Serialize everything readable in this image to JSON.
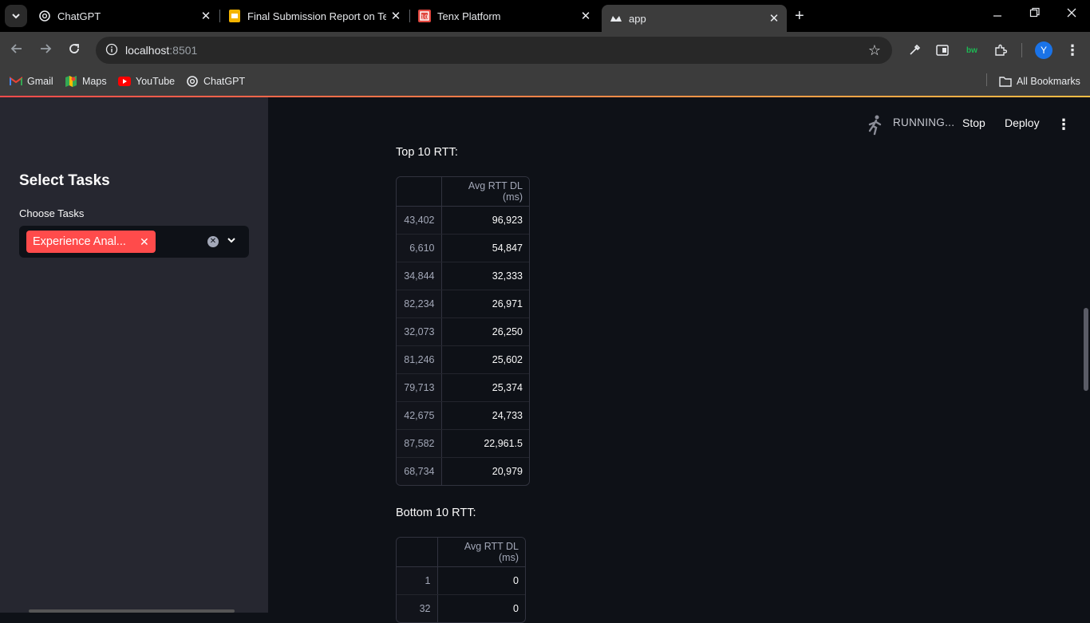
{
  "browser": {
    "tabs": [
      {
        "title": "ChatGPT",
        "icon": "chatgpt-icon",
        "active": false
      },
      {
        "title": "Final Submission Report on Tell",
        "icon": "slides-icon",
        "active": false
      },
      {
        "title": "Tenx Platform",
        "icon": "tenx-icon",
        "active": false
      },
      {
        "title": "app",
        "icon": "streamlit-icon",
        "active": true
      }
    ],
    "url_host": "localhost",
    "url_port": ":8501",
    "bookmarks": [
      {
        "label": "Gmail",
        "icon": "gmail-icon"
      },
      {
        "label": "Maps",
        "icon": "maps-icon"
      },
      {
        "label": "YouTube",
        "icon": "youtube-icon"
      },
      {
        "label": "ChatGPT",
        "icon": "chatgpt-icon"
      }
    ],
    "all_bookmarks": "All Bookmarks",
    "profile_initial": "Y",
    "extension_badge": "bw"
  },
  "sidebar": {
    "title": "Select Tasks",
    "label": "Choose Tasks",
    "selected_chip": "Experience Analytics",
    "chip_display": "Experience Anal..."
  },
  "status_bar": {
    "running": "RUNNING...",
    "stop": "Stop",
    "deploy": "Deploy"
  },
  "top_table": {
    "heading": "Top 10 RTT:",
    "column": "Avg RTT DL (ms)",
    "rows": [
      {
        "index": "43,402",
        "value": "96,923"
      },
      {
        "index": "6,610",
        "value": "54,847"
      },
      {
        "index": "34,844",
        "value": "32,333"
      },
      {
        "index": "82,234",
        "value": "26,971"
      },
      {
        "index": "32,073",
        "value": "26,250"
      },
      {
        "index": "81,246",
        "value": "25,602"
      },
      {
        "index": "79,713",
        "value": "25,374"
      },
      {
        "index": "42,675",
        "value": "24,733"
      },
      {
        "index": "87,582",
        "value": "22,961.5"
      },
      {
        "index": "68,734",
        "value": "20,979"
      }
    ]
  },
  "bottom_table": {
    "heading": "Bottom 10 RTT:",
    "column": "Avg RTT DL (ms)",
    "rows": [
      {
        "index": "1",
        "value": "0"
      },
      {
        "index": "32",
        "value": "0"
      }
    ]
  },
  "colors": {
    "accent": "#ff4b4b",
    "app_bg": "#0e1117",
    "sidebar_bg": "#262730"
  }
}
